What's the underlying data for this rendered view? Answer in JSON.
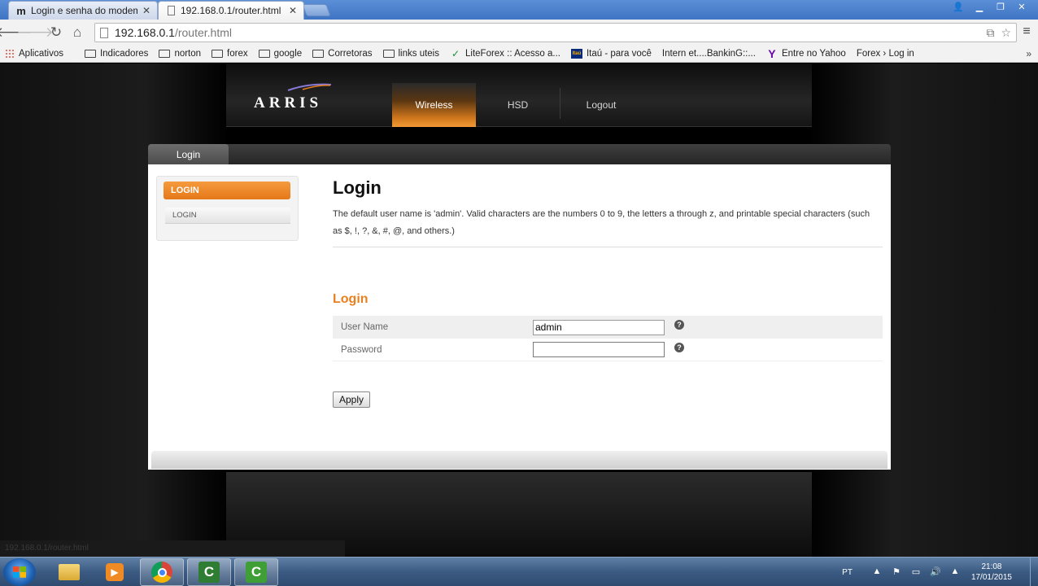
{
  "browser": {
    "tabs": [
      {
        "label": "Login e senha do modem",
        "close": "✕",
        "favicon": "m"
      },
      {
        "label": "192.168.0.1/router.html",
        "close": "✕"
      }
    ],
    "url_host": "192.168.0.1",
    "url_path": "/router.html",
    "bookmarks": [
      {
        "label": "Aplicativos",
        "icon": "apps-grid-icon"
      },
      {
        "label": "",
        "icon": "page-icon"
      },
      {
        "label": "Indicadores",
        "icon": "folder-icon"
      },
      {
        "label": "norton",
        "icon": "folder-icon"
      },
      {
        "label": "forex",
        "icon": "folder-icon"
      },
      {
        "label": "google",
        "icon": "folder-icon"
      },
      {
        "label": "Corretoras",
        "icon": "folder-icon"
      },
      {
        "label": "links uteis",
        "icon": "folder-icon"
      },
      {
        "label": "LiteForex :: Acesso a...",
        "icon": "liteforex-icon"
      },
      {
        "label": "Itaú - para você",
        "icon": "itau-icon"
      },
      {
        "label": "Intern et....BankinG::...",
        "icon": "page-icon"
      },
      {
        "label": "Entre no Yahoo",
        "icon": "yahoo-icon"
      },
      {
        "label": "Forex › Log in",
        "icon": "page-icon"
      }
    ],
    "bookmarks_more": "»"
  },
  "router": {
    "logo": "ARRIS",
    "nav": [
      {
        "label": "Wireless",
        "active": true
      },
      {
        "label": "HSD",
        "active": false
      },
      {
        "label": "Logout",
        "active": false
      }
    ],
    "panel_tab": "Login",
    "side_header": "LOGIN",
    "side_item": "LOGIN",
    "title": "Login",
    "description": "The default user name is 'admin'. Valid characters are the numbers 0 to 9, the letters a through z, and printable special characters (such as $, !, ?, &, #, @, and others.)",
    "section_title": "Login",
    "fields": {
      "username_label": "User Name",
      "username_value": "admin",
      "password_label": "Password",
      "password_value": ""
    },
    "help_glyph": "?",
    "apply_label": "Apply",
    "status_url": "192.168.0.1/router.html",
    "colors": {
      "accent": "#e8801f"
    }
  },
  "taskbar": {
    "language": "PT",
    "time": "21:08",
    "date": "17/01/2015"
  }
}
